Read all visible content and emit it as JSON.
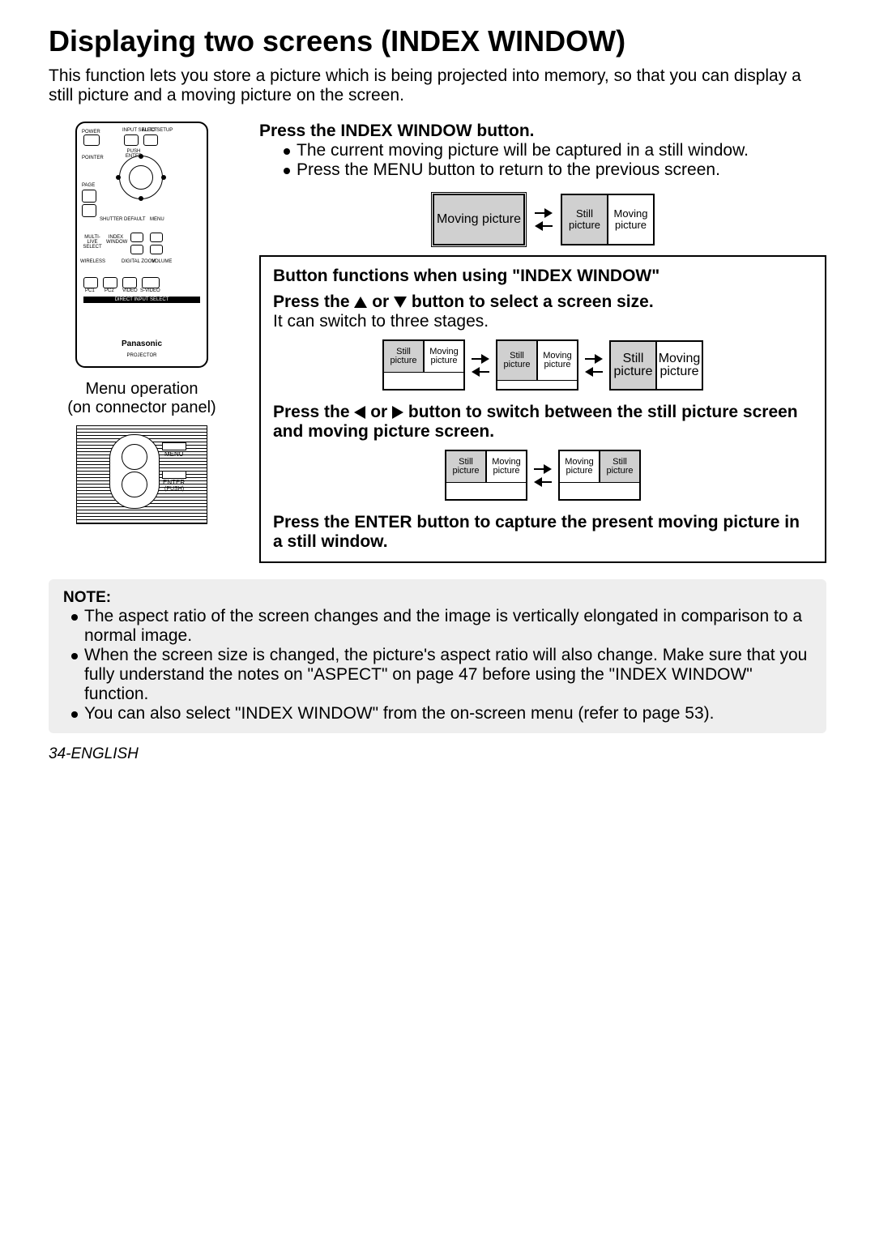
{
  "title": "Displaying two screens (INDEX WINDOW)",
  "intro": "This function lets you store a picture which is being projected into memory, so that you can display a still picture and a moving picture on the screen.",
  "remote_caption1": "Menu operation",
  "remote_caption2": "(on connector panel)",
  "remote": {
    "power": "POWER",
    "input_select": "INPUT SELECT",
    "auto_setup": "AUTO SETUP",
    "pointer": "POINTER",
    "push_enter": "PUSH ENTER",
    "page": "PAGE",
    "shutter": "SHUTTER",
    "default": "DEFAULT",
    "menu": "MENU",
    "multi_live": "MULTI-LIVE SELECT",
    "index_window": "INDEX WINDOW",
    "wireless": "WIRELESS",
    "digital_zoom": "DIGITAL ZOOM",
    "volume": "VOLUME",
    "pc1": "PC1",
    "pc2": "PC2",
    "video": "VIDEO",
    "svideo": "S-VIDEO",
    "direct": "DIRECT INPUT SELECT",
    "brand": "Panasonic",
    "projector": "PROJECTOR"
  },
  "panel": {
    "menu": "MENU",
    "enter": "ENTER",
    "push": "(PUSH)"
  },
  "step1": {
    "heading": "Press the INDEX WINDOW button.",
    "b1": "The current moving picture will be captured in a still window.",
    "b2": "Press the MENU button to return to the previous screen."
  },
  "labels": {
    "moving": "Moving picture",
    "still": "Still picture",
    "moving_s": "Moving",
    "still_s": "Still",
    "picture": "picture"
  },
  "box": {
    "h1": "Button functions when using \"INDEX WINDOW\"",
    "h2_pre": "Press the ",
    "h2_mid": " or ",
    "h2_post": " button to select a screen size.",
    "t1": "It can switch to three stages.",
    "h3_pre": "Press the ",
    "h3_mid": " or ",
    "h3_post": " button to switch between the still picture screen and moving picture screen.",
    "h4": "Press the ENTER button to capture the present moving picture in a still window."
  },
  "note_title": "NOTE:",
  "notes": [
    "The aspect ratio of the screen changes and the image is vertically elongated in comparison to a normal image.",
    "When the screen size is changed, the picture's aspect ratio will also change. Make sure that you fully understand the notes on \"ASPECT\" on page 47 before using the \"INDEX WINDOW\" function.",
    "You can also select \"INDEX WINDOW\" from the on-screen menu (refer to page 53)."
  ],
  "footer": "34-ENGLISH"
}
